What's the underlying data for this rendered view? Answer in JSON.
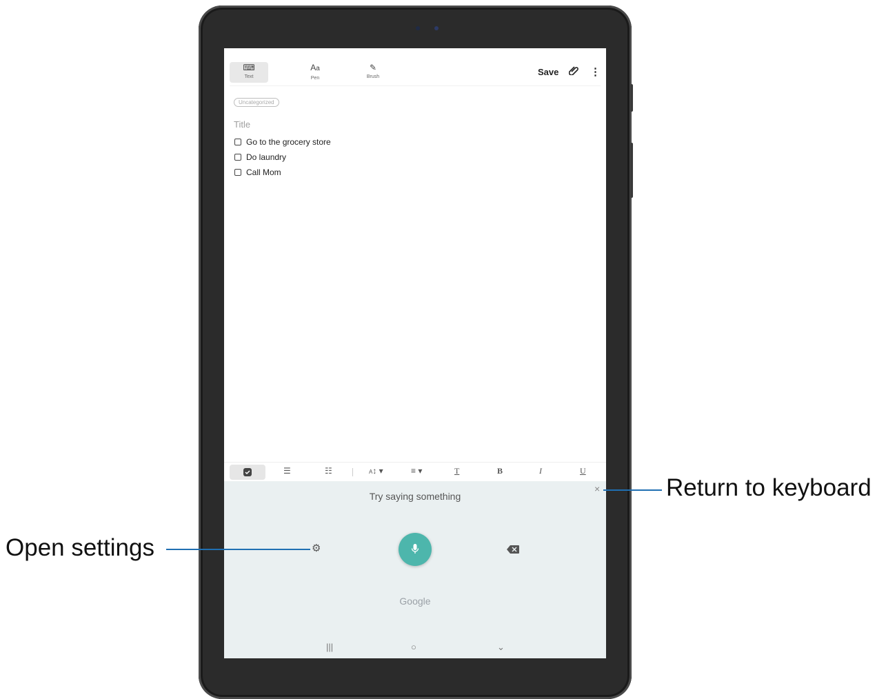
{
  "toolbar": {
    "modes": [
      {
        "label": "Text",
        "icon": "keyboard-icon"
      },
      {
        "label": "Pen",
        "icon": "pen-icon"
      },
      {
        "label": "Brush",
        "icon": "brush-icon"
      }
    ],
    "save_label": "Save",
    "attach_icon": "paperclip-icon",
    "more_icon": "more-vertical-icon"
  },
  "note": {
    "category": "Uncategorized",
    "title_placeholder": "Title",
    "checklist": [
      "Go to the grocery store",
      "Do laundry",
      "Call Mom"
    ]
  },
  "format_bar": {
    "items": [
      "checkbox-icon",
      "numbered-list-icon",
      "bullet-list-icon",
      "font-size-icon",
      "align-icon",
      "text-color-icon",
      "bold-icon",
      "italic-icon",
      "underline-icon"
    ]
  },
  "voice": {
    "prompt": "Try saying something",
    "provider": "Google",
    "accent_color": "#4db6ac"
  },
  "callouts": {
    "return_to_keyboard": "Return to keyboard",
    "open_settings": "Open settings"
  }
}
